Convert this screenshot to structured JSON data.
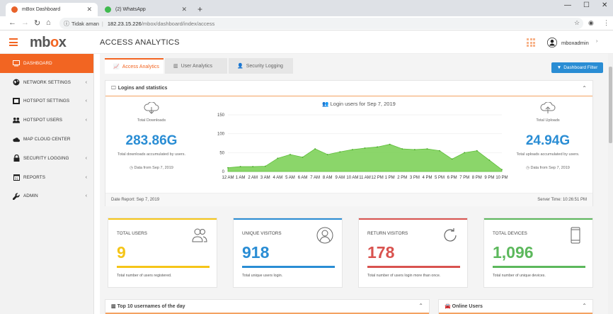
{
  "browser": {
    "tabs": [
      {
        "title": "mBox Dashboard",
        "active": true
      },
      {
        "title": "(2) WhatsApp",
        "active": false
      }
    ],
    "insecure_label": "Tidak aman",
    "url_host": "182.23.15.226",
    "url_path": "/mbox/dashboard/index/access"
  },
  "header": {
    "logo_prefix": "mb",
    "logo_o": "o",
    "logo_suffix": "x",
    "page_title": "ACCESS ANALYTICS",
    "username": "mboxadmin"
  },
  "sidebar": {
    "items": [
      {
        "label": "DASHBOARD",
        "icon": "monitor-icon",
        "active": true,
        "chevron": false
      },
      {
        "label": "NETWORK SETTINGS",
        "icon": "globe-icon",
        "active": false,
        "chevron": true
      },
      {
        "label": "HOTSPOT SETTINGS",
        "icon": "hotspot-icon",
        "active": false,
        "chevron": true
      },
      {
        "label": "HOTSPOT USERS",
        "icon": "users-icon",
        "active": false,
        "chevron": true
      },
      {
        "label": "MAP CLOUD CENTER",
        "icon": "cloud-icon",
        "active": false,
        "chevron": false
      },
      {
        "label": "SECURITY LOGGING",
        "icon": "lock-icon",
        "active": false,
        "chevron": true
      },
      {
        "label": "REPORTS",
        "icon": "calendar-icon",
        "active": false,
        "chevron": true
      },
      {
        "label": "ADMIN",
        "icon": "wrench-icon",
        "active": false,
        "chevron": true
      }
    ]
  },
  "tabs": [
    {
      "label": "Access Analytics",
      "icon": "line-chart-icon",
      "active": true
    },
    {
      "label": "User Analytics",
      "icon": "bar-chart-icon",
      "active": false
    },
    {
      "label": "Security Logging",
      "icon": "user-shield-icon",
      "active": false
    }
  ],
  "filter_button": "Dashboard Filter",
  "logins_panel": {
    "title": "Logins and statistics",
    "downloads": {
      "label": "Total Downloads",
      "value": "283.86G",
      "desc": "Total downloads accumulated by users.",
      "foot": "Data from Sep 7, 2019"
    },
    "uploads": {
      "label": "Total Uploads",
      "value": "24.94G",
      "desc": "Total uploads accumulated by users.",
      "foot": "Data from Sep 7, 2019"
    },
    "chart_title": "Login users for Sep 7, 2019",
    "report_date": "Date Report: Sep 7, 2019",
    "server_time": "Server Time: 10:26:51 PM"
  },
  "chart_data": {
    "type": "area",
    "title": "Login users for Sep 7, 2019",
    "x": [
      "12 AM",
      "1 AM",
      "2 AM",
      "3 AM",
      "4 AM",
      "5 AM",
      "6 AM",
      "7 AM",
      "8 AM",
      "9 AM",
      "10 AM",
      "11 AM",
      "12 PM",
      "1 PM",
      "2 PM",
      "3 PM",
      "4 PM",
      "5 PM",
      "6 PM",
      "7 PM",
      "8 PM",
      "9 PM",
      "10 PM"
    ],
    "series": [
      {
        "values": [
          10,
          13,
          13,
          14,
          35,
          45,
          38,
          60,
          45,
          52,
          58,
          62,
          65,
          72,
          60,
          58,
          60,
          55,
          33,
          50,
          55,
          30,
          5
        ]
      }
    ],
    "yticks": [
      0,
      50,
      100,
      150
    ],
    "ylim": [
      0,
      150
    ],
    "grid": true,
    "color": "#7ed25a"
  },
  "cards": [
    {
      "title": "TOTAL USERS",
      "value": "9",
      "desc": "Total number of users registered.",
      "color": "#f5c518",
      "icon": "users-outline-icon"
    },
    {
      "title": "UNIQUE VISITORS",
      "value": "918",
      "desc": "Total unique users login.",
      "color": "#2a8dd4",
      "icon": "user-circle-icon"
    },
    {
      "title": "RETURN VISITORS",
      "value": "178",
      "desc": "Total number of users login more than once.",
      "color": "#d9534f",
      "icon": "refresh-icon"
    },
    {
      "title": "TOTAL DEVICES",
      "value": "1,096",
      "desc": "Total number of unique devices.",
      "color": "#5cb85c",
      "icon": "mobile-icon"
    }
  ],
  "bottom": {
    "top10_title": "Top 10 usernames of the day",
    "online_title": "Online Users"
  }
}
